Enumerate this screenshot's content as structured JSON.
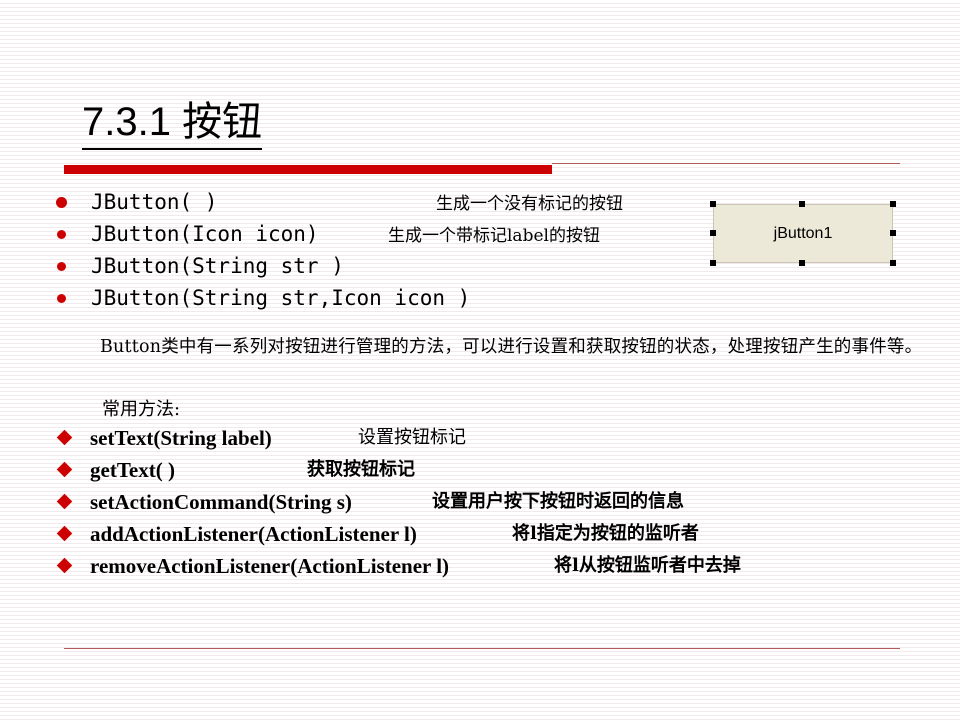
{
  "slide": {
    "title": "7.3.1 按钮",
    "colors": {
      "accent": "#cc0000",
      "rule": "#b55a5a"
    },
    "constructors": [
      {
        "signature": "JButton( )",
        "description": "生成一个没有标记的按钮"
      },
      {
        "signature": "JButton(Icon icon)",
        "description": "生成一个带标记label的按钮"
      },
      {
        "signature": "JButton(String str )",
        "description": ""
      },
      {
        "signature": "JButton(String str,Icon icon )",
        "description": ""
      }
    ],
    "button_demo": {
      "label": "jButton1"
    },
    "paragraph": "Button类中有一系列对按钮进行管理的方法，可以进行设置和获取按钮的状态，处理按钮产生的事件等。",
    "methods_heading": "常用方法:",
    "methods": [
      {
        "signature": "setText(String label)",
        "description": "设置按钮标记"
      },
      {
        "signature": "getText( )",
        "description": "获取按钮标记"
      },
      {
        "signature": "setActionCommand(String s)",
        "description": "设置用户按下按钮时返回的信息"
      },
      {
        "signature": "addActionListener(ActionListener l)",
        "description": "将l指定为按钮的监听者"
      },
      {
        "signature": "removeActionListener(ActionListener l)",
        "description": "将l从按钮监听者中去掉"
      }
    ]
  }
}
